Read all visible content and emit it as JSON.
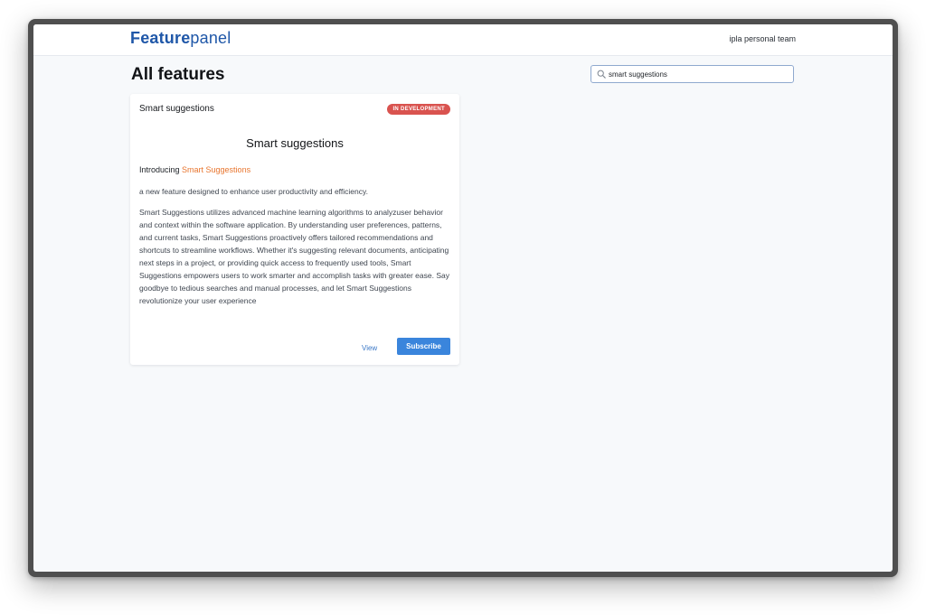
{
  "header": {
    "logo_primary": "Feature",
    "logo_secondary": "panel",
    "team_name": "ipla personal team"
  },
  "page": {
    "title": "All features"
  },
  "search": {
    "value": "smart suggestions",
    "icon": "search-icon"
  },
  "feature_card": {
    "title": "Smart suggestions",
    "status": "IN DEVELOPMENT",
    "heading": "Smart suggestions",
    "intro_prefix": "Introducing ",
    "intro_highlight": "Smart Suggestions",
    "paragraph_1": "a new feature designed to enhance user productivity and efficiency.",
    "paragraph_2": "Smart Suggestions utilizes advanced machine learning algorithms to analyzuser behavior and context within the software application. By understanding user preferences, patterns, and current tasks, Smart Suggestions proactively offers tailored recommendations and shortcuts to streamline workflows. Whether it's suggesting relevant documents, anticipating next steps in a project, or providing quick access to frequently used tools, Smart Suggestions empowers users to work smarter and accomplish tasks with greater ease. Say goodbye to tedious searches and manual processes, and let Smart Suggestions revolutionize your user experience",
    "view_label": "View",
    "subscribe_label": "Subscribe"
  },
  "colors": {
    "brand": "#1f57a8",
    "badge": "#d9534f",
    "highlight": "#e8752e",
    "button": "#3a85dc",
    "link": "#3b78c7"
  }
}
